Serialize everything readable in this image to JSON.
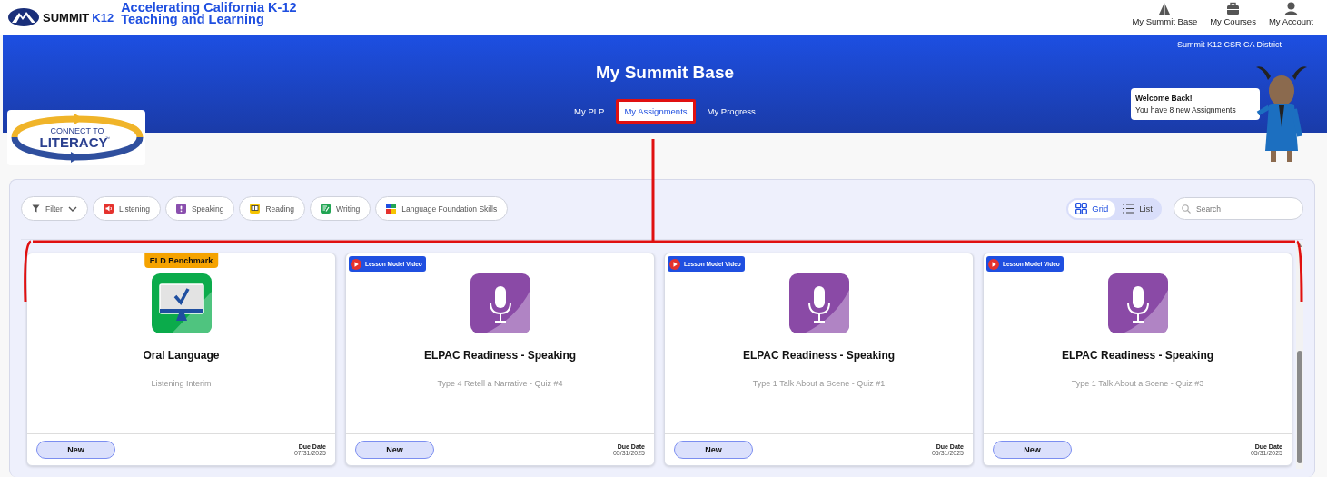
{
  "header": {
    "brand": "SUMMIT",
    "brand_suffix": "K12",
    "tagline": [
      "Accelerating California K-12",
      "Teaching and Learning"
    ],
    "nav": [
      {
        "label": "My Summit Base",
        "kind": "mountain"
      },
      {
        "label": "My Courses",
        "kind": "briefcase"
      },
      {
        "label": "My Account",
        "kind": "person"
      }
    ]
  },
  "banner": {
    "district": "Summit K12 CSR CA District",
    "title": "My Summit Base",
    "tabs": [
      {
        "label": "My PLP",
        "selected": false
      },
      {
        "label": "My Assignments",
        "selected": true
      },
      {
        "label": "My Progress",
        "selected": false
      }
    ],
    "program_logo": {
      "line1": "CONNECT TO",
      "line2": "LITERACY",
      "mark": "™"
    },
    "welcome": {
      "heading": "Welcome Back!",
      "message": "You have 8 new Assignments"
    }
  },
  "filters": [
    {
      "label": "Filter",
      "kind": "dropdown"
    },
    {
      "label": "Listening",
      "kind": "listening"
    },
    {
      "label": "Speaking",
      "kind": "speaking"
    },
    {
      "label": "Reading",
      "kind": "reading"
    },
    {
      "label": "Writing",
      "kind": "writing"
    },
    {
      "label": "Language Foundation Skills",
      "kind": "foundation"
    }
  ],
  "view_toggle": [
    {
      "label": "Grid",
      "kind": "grid",
      "selected": true
    },
    {
      "label": "List",
      "kind": "list",
      "selected": false
    }
  ],
  "search": {
    "placeholder": "Search"
  },
  "cards": [
    {
      "kind": "benchmark",
      "badge": {
        "kind": "benchmark",
        "label": "ELD Benchmark"
      },
      "title": "Oral Language",
      "subtitle": "Listening Interim",
      "status": "New",
      "due_label": "Due Date",
      "due_date": "07/31/2025"
    },
    {
      "kind": "speaking",
      "badge": {
        "kind": "video",
        "label": "Lesson Model Video"
      },
      "title": "ELPAC Readiness - Speaking",
      "subtitle": "Type 4 Retell a Narrative - Quiz #4",
      "status": "New",
      "due_label": "Due Date",
      "due_date": "05/31/2025"
    },
    {
      "kind": "speaking",
      "badge": {
        "kind": "video",
        "label": "Lesson Model Video"
      },
      "title": "ELPAC Readiness - Speaking",
      "subtitle": "Type 1 Talk About a Scene - Quiz #1",
      "status": "New",
      "due_label": "Due Date",
      "due_date": "05/31/2025"
    },
    {
      "kind": "speaking",
      "badge": {
        "kind": "video",
        "label": "Lesson Model Video"
      },
      "title": "ELPAC Readiness - Speaking",
      "subtitle": "Type 1 Talk About a Scene - Quiz #3",
      "status": "New",
      "due_label": "Due Date",
      "due_date": "05/31/2025"
    }
  ]
}
